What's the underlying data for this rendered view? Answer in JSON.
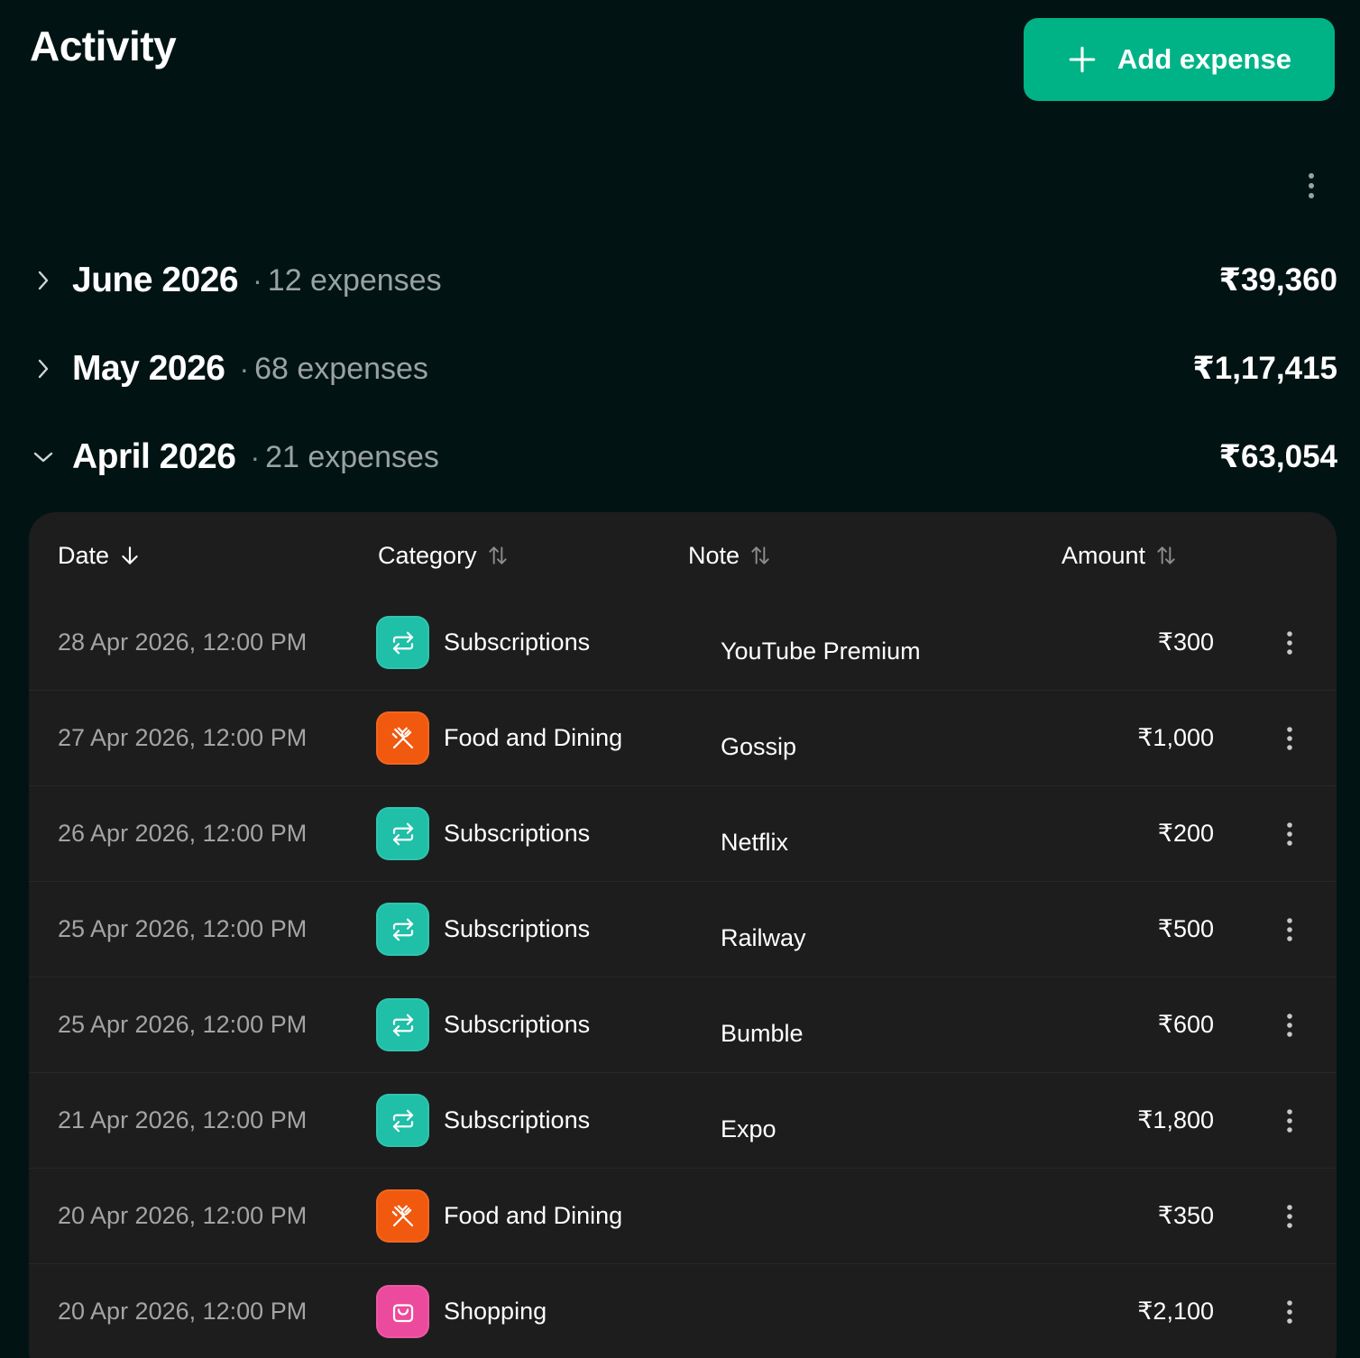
{
  "header": {
    "title": "Activity",
    "add_button_label": "Add expense"
  },
  "months": [
    {
      "name": "June 2026",
      "separator": "·",
      "count": "12 expenses",
      "total": "₹39,360",
      "expanded": false
    },
    {
      "name": "May 2026",
      "separator": "·",
      "count": "68 expenses",
      "total": "₹1,17,415",
      "expanded": false
    },
    {
      "name": "April 2026",
      "separator": "·",
      "count": "21 expenses",
      "total": "₹63,054",
      "expanded": true
    }
  ],
  "table": {
    "columns": {
      "date": "Date",
      "category": "Category",
      "note": "Note",
      "amount": "Amount"
    },
    "rows": [
      {
        "date": "28 Apr 2026, 12:00 PM",
        "category": "Subscriptions",
        "note": "YouTube Premium",
        "amount": "₹300"
      },
      {
        "date": "27 Apr 2026, 12:00 PM",
        "category": "Food and Dining",
        "note": "Gossip",
        "amount": "₹1,000"
      },
      {
        "date": "26 Apr 2026, 12:00 PM",
        "category": "Subscriptions",
        "note": "Netflix",
        "amount": "₹200"
      },
      {
        "date": "25 Apr 2026, 12:00 PM",
        "category": "Subscriptions",
        "note": "Railway",
        "amount": "₹500"
      },
      {
        "date": "25 Apr 2026, 12:00 PM",
        "category": "Subscriptions",
        "note": "Bumble",
        "amount": "₹600"
      },
      {
        "date": "21 Apr 2026, 12:00 PM",
        "category": "Subscriptions",
        "note": "Expo",
        "amount": "₹1,800"
      },
      {
        "date": "20 Apr 2026, 12:00 PM",
        "category": "Food and Dining",
        "note": "",
        "amount": "₹350"
      },
      {
        "date": "20 Apr 2026, 12:00 PM",
        "category": "Shopping",
        "note": "",
        "amount": "₹2,100"
      }
    ]
  },
  "colors": {
    "background": "#021313",
    "accent": "#00b386",
    "card": "#1d1d1d",
    "subscriptions": "#1fbfa8",
    "food_and_dining": "#f1590f",
    "shopping": "#ec4a9c"
  },
  "icons": {
    "add": "plus-icon",
    "more": "more-vertical-icon",
    "collapsed": "chevron-right-icon",
    "expanded": "chevron-down-icon",
    "sort_active": "arrow-down-icon",
    "sort_idle": "sort-arrows-icon",
    "subscriptions": "repeat-icon",
    "food_and_dining": "fork-knife-icon",
    "shopping": "shopping-bag-icon"
  }
}
